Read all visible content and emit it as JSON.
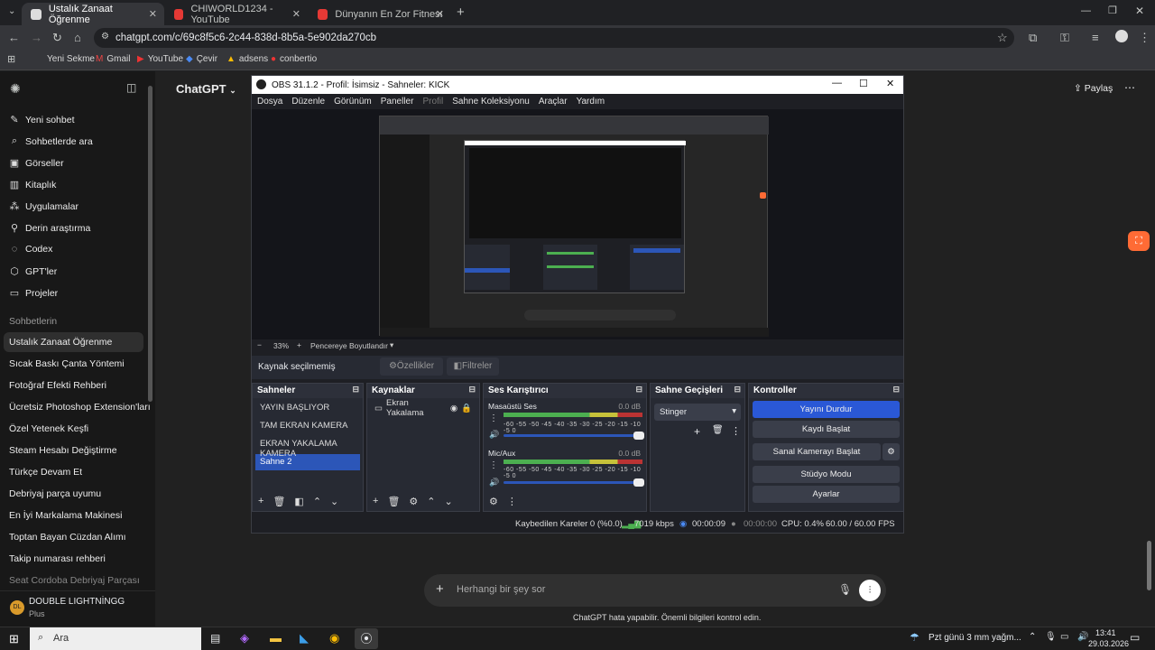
{
  "browser": {
    "tabs": [
      {
        "title": "Ustalık Zanaat Öğrenme",
        "active": true
      },
      {
        "title": "CHIWORLD1234 - YouTube"
      },
      {
        "title": "Dünyanın En Zor Fitness Yarışm"
      }
    ],
    "url": "chatgpt.com/c/69c8f5c6-2c44-838d-8b5a-5e902da270cb",
    "bookmarks": [
      "Yeni Sekme",
      "Gmail",
      "YouTube",
      "Çevir",
      "adsens",
      "conbertio"
    ]
  },
  "chatgpt": {
    "model": "ChatGPT",
    "share": "Paylaş",
    "nav": [
      "Yeni sohbet",
      "Sohbetlerde ara",
      "Görseller",
      "Kitaplık",
      "Uygulamalar",
      "Derin araştırma",
      "Codex",
      "GPT'ler",
      "Projeler"
    ],
    "chats_heading": "Sohbetlerin",
    "chats": [
      "Ustalık Zanaat Öğrenme",
      "Sıcak Baskı Çanta Yöntemi",
      "Fotoğraf Efekti Rehberi",
      "Ücretsiz Photoshop Extension'ları",
      "Özel Yetenek Keşfi",
      "Steam Hesabı Değiştirme",
      "Türkçe Devam Et",
      "Debriyaj parça uyumu",
      "En İyi Markalama Makinesi",
      "Toptan Bayan Cüzdan Alımı",
      "Takip numarası rehberi",
      "Seat Cordoba Debriyaj Parçası"
    ],
    "user": {
      "initials": "DL",
      "name": "DOUBLE LIGHTNİNGG",
      "plan": "Plus"
    },
    "composer_placeholder": "Herhangi bir şey sor",
    "disclaimer": "ChatGPT hata yapabilir. Önemli bilgileri kontrol edin."
  },
  "obs": {
    "title": "OBS 31.1.2 - Profil: İsimsiz - Sahneler: KICK",
    "menu": [
      "Dosya",
      "Düzenle",
      "Görünüm",
      "Paneller",
      "Profil",
      "Sahne Koleksiyonu",
      "Araçlar",
      "Yardım"
    ],
    "zoom": "33%",
    "zoom_mode": "Pencereye Boyutlandır",
    "source_bar": {
      "label": "Kaynak seçilmemiş",
      "properties": "Özellikler",
      "filters": "Filtreler"
    },
    "scenes": {
      "title": "Sahneler",
      "items": [
        "YAYIN BAŞLIYOR",
        "TAM EKRAN KAMERA",
        "EKRAN YAKALAMA KAMERA",
        "Sahne 2"
      ],
      "selected": 3
    },
    "sources": {
      "title": "Kaynaklar",
      "items": [
        "Ekran Yakalama"
      ]
    },
    "mixer": {
      "title": "Ses Karıştırıcı",
      "channels": [
        {
          "name": "Masaüstü Ses",
          "db": "0.0 dB",
          "level": 0.0
        },
        {
          "name": "Mic/Aux",
          "db": "0.0 dB",
          "level": 0.0
        }
      ],
      "scale": "-60 -55 -50 -45 -40 -35 -30 -25 -20 -15 -10 -5 0"
    },
    "transitions": {
      "title": "Sahne Geçişleri",
      "selected": "Stinger"
    },
    "controls": {
      "title": "Kontroller",
      "buttons": [
        "Yayını Durdur",
        "Kaydı Başlat",
        "Sanal Kamerayı Başlat",
        "Stüdyo Modu",
        "Ayarlar"
      ]
    },
    "status": {
      "dropped": "Kaybedilen Kareler 0 (%0.0)",
      "bitrate": "7019 kbps",
      "stream_time": "00:00:09",
      "rec_time": "00:00:00",
      "cpu": "CPU: 0.4%",
      "fps": "60.00 / 60.00 FPS"
    }
  },
  "taskbar": {
    "search": "Ara",
    "weather": "Pzt günü 3 mm yağm...",
    "time": "13:41",
    "date": "29.03.2026"
  },
  "colors": {
    "obs_blue": "#2c56b8",
    "accent_orange": "#ff6b35"
  }
}
